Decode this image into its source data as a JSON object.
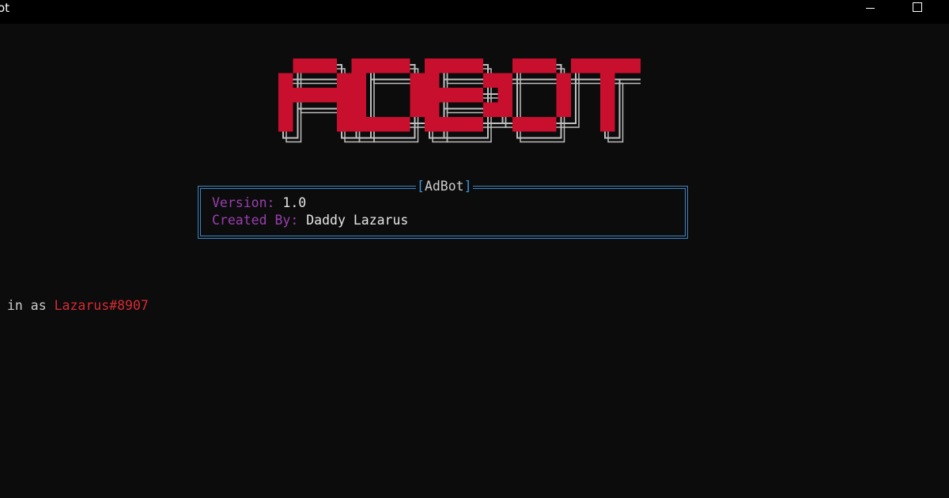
{
  "window": {
    "title": "AdBot",
    "title_visible": "ot",
    "controls": [
      "minimize-icon",
      "maximize-icon"
    ]
  },
  "banner": {
    "text": "ADBOT",
    "fill_color": "#c8102e",
    "outline_color": "#bfbfbf"
  },
  "info_box": {
    "title_open": "[",
    "title": "AdBot",
    "title_close": "]",
    "border_color": "#3a86c4",
    "rows": [
      {
        "key": "Version:",
        "value": "1.0"
      },
      {
        "key": "Created By:",
        "value": "Daddy Lazarus"
      }
    ]
  },
  "status": {
    "prefix": "in as",
    "username": "Lazarus#8907"
  },
  "colors": {
    "background": "#0c0c0c",
    "titlebar": "#000000",
    "key_purple": "#9a3fb0",
    "user_red": "#d42b34"
  }
}
